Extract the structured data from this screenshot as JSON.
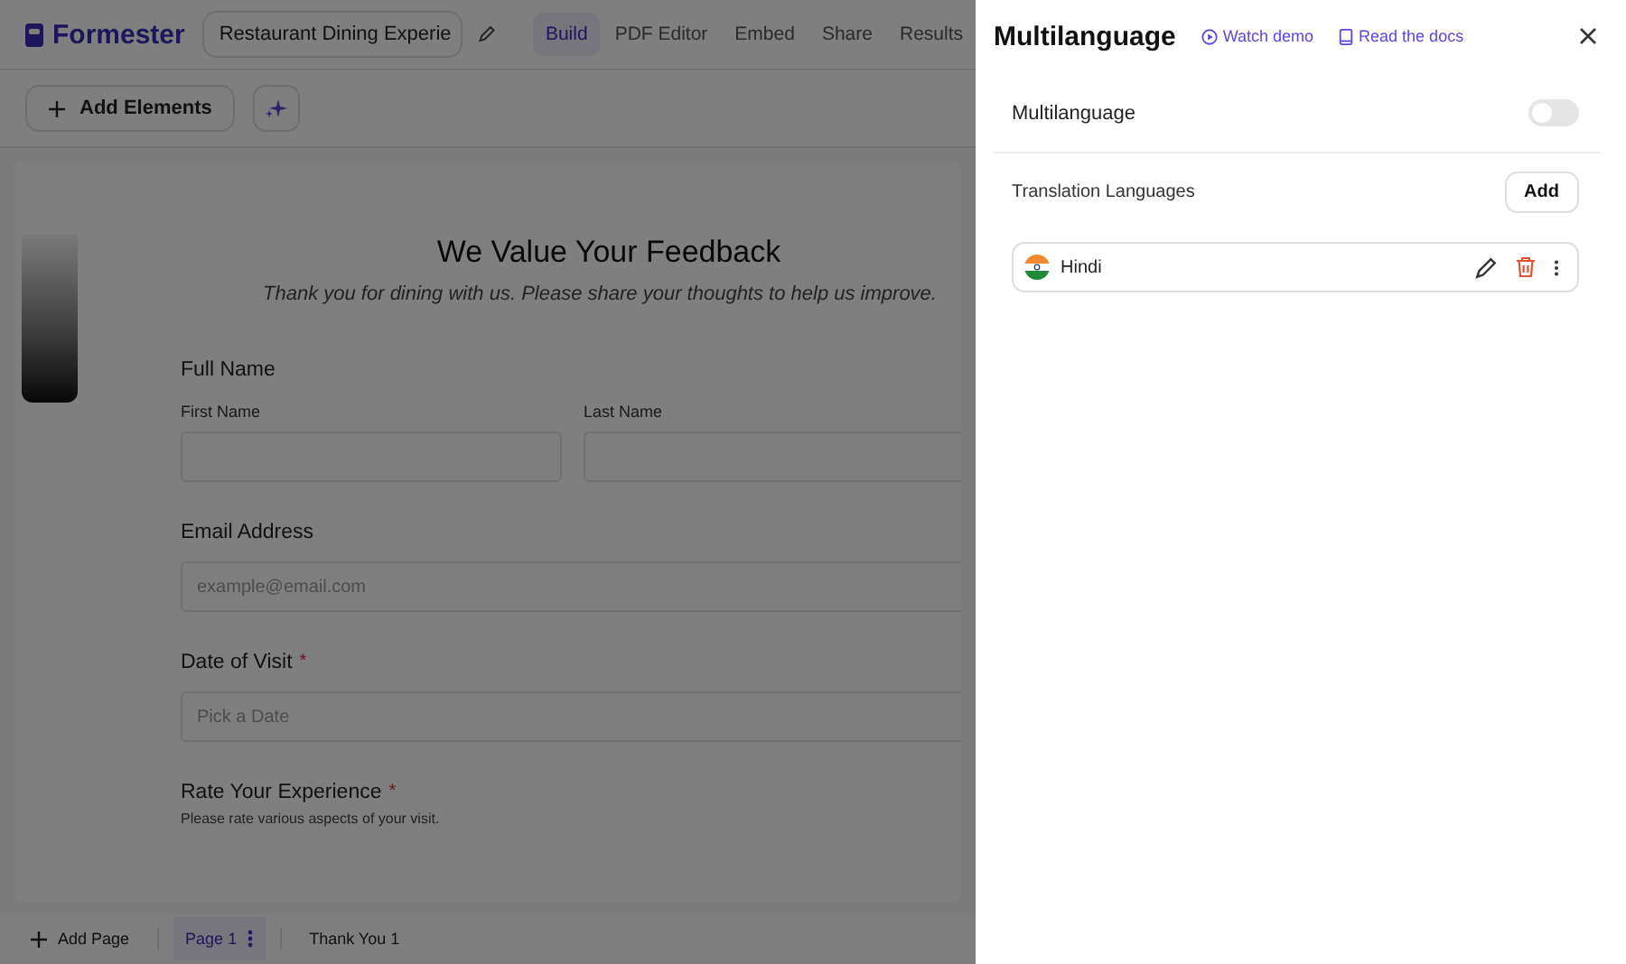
{
  "app": {
    "logo": "Formester",
    "form_name": "Restaurant Dining Experie"
  },
  "tabs": [
    {
      "label": "Build",
      "selected": true
    },
    {
      "label": "PDF Editor",
      "selected": false
    },
    {
      "label": "Embed",
      "selected": false
    },
    {
      "label": "Share",
      "selected": false
    },
    {
      "label": "Results",
      "selected": false
    }
  ],
  "toolbar": {
    "add_button": "Add Elements"
  },
  "form": {
    "title": "We Value Your Feedback",
    "subtitle": "Thank you for dining with us. Please share your thoughts to help us improve.",
    "fields": [
      {
        "kind": "name",
        "label": "Full Name",
        "parts": [
          "First Name",
          "Last Name"
        ]
      },
      {
        "kind": "input",
        "label": "Email Address",
        "placeholder": "example@email.com"
      },
      {
        "kind": "input",
        "label": "Date of Visit",
        "required_mark": "*",
        "placeholder": "Pick a Date"
      },
      {
        "kind": "rating",
        "label": "Rate Your Experience",
        "required_mark": "*",
        "description": "Please rate various aspects of your visit."
      }
    ]
  },
  "pages": {
    "add": "Add Page",
    "items": [
      {
        "label": "Page 1",
        "selected": true
      },
      {
        "label": "Thank You 1",
        "selected": false
      }
    ]
  },
  "panel": {
    "title": "Multilanguage",
    "watch_demo": "Watch demo",
    "read_docs": "Read the docs",
    "toggle": {
      "label": "Multilanguage",
      "on": false
    },
    "languages_label": "Translation Languages",
    "add_button": "Add",
    "languages": [
      {
        "name": "Hindi"
      }
    ]
  }
}
